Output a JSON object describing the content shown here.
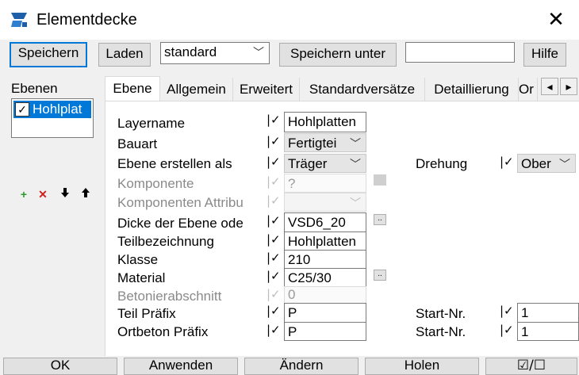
{
  "window": {
    "title": "Elementdecke",
    "close_glyph": "✕"
  },
  "toolbar": {
    "save_label": "Speichern",
    "load_label": "Laden",
    "preset_value": "standard",
    "save_as_label": "Speichern unter",
    "name_value": "",
    "help_label": "Hilfe"
  },
  "layers": {
    "heading": "Ebenen",
    "items": [
      {
        "label": "Hohlplat",
        "checked": true
      }
    ],
    "add_icon": "+",
    "delete_icon": "✕",
    "down_icon": "🠗",
    "up_icon": "🠕"
  },
  "tabs": [
    {
      "label": "Ebene",
      "active": true
    },
    {
      "label": "Allgemein"
    },
    {
      "label": "Erweitert"
    },
    {
      "label": "Standardversätze"
    },
    {
      "label": "Detaillierung"
    },
    {
      "label": "Or"
    }
  ],
  "tab_scroll": {
    "left": "◂",
    "right": "▸"
  },
  "form": {
    "layername": {
      "label": "Layername",
      "value": "Hohlplatten"
    },
    "bauart": {
      "label": "Bauart",
      "value": "Fertigtei"
    },
    "ebene_als": {
      "label": "Ebene erstellen als",
      "value": "Träger"
    },
    "komponente": {
      "label": "Komponente",
      "value": "?"
    },
    "komp_attr": {
      "label": "Komponenten Attribu",
      "value": ""
    },
    "dicke": {
      "label": "Dicke der Ebene ode",
      "value": "VSD6_20"
    },
    "teilbez": {
      "label": "Teilbezeichnung",
      "value": "Hohlplatten"
    },
    "klasse": {
      "label": "Klasse",
      "value": "210"
    },
    "material": {
      "label": "Material",
      "value": "C25/30"
    },
    "betonier": {
      "label": "Betonierabschnitt",
      "value": "0"
    },
    "teil_praefix": {
      "label": "Teil Präfix",
      "value": "P"
    },
    "ortbeton_praefix": {
      "label": "Ortbeton Präfix",
      "value": "P"
    },
    "drehung": {
      "label": "Drehung",
      "value": "Ober"
    },
    "start_nr_1": {
      "label": "Start-Nr.",
      "value": "1"
    },
    "start_nr_2": {
      "label": "Start-Nr.",
      "value": "1"
    },
    "check_glyph": "|✓",
    "dots": ".."
  },
  "bottom": {
    "ok": "OK",
    "apply": "Anwenden",
    "modify": "Ändern",
    "get": "Holen",
    "toggle": "☑/☐"
  }
}
